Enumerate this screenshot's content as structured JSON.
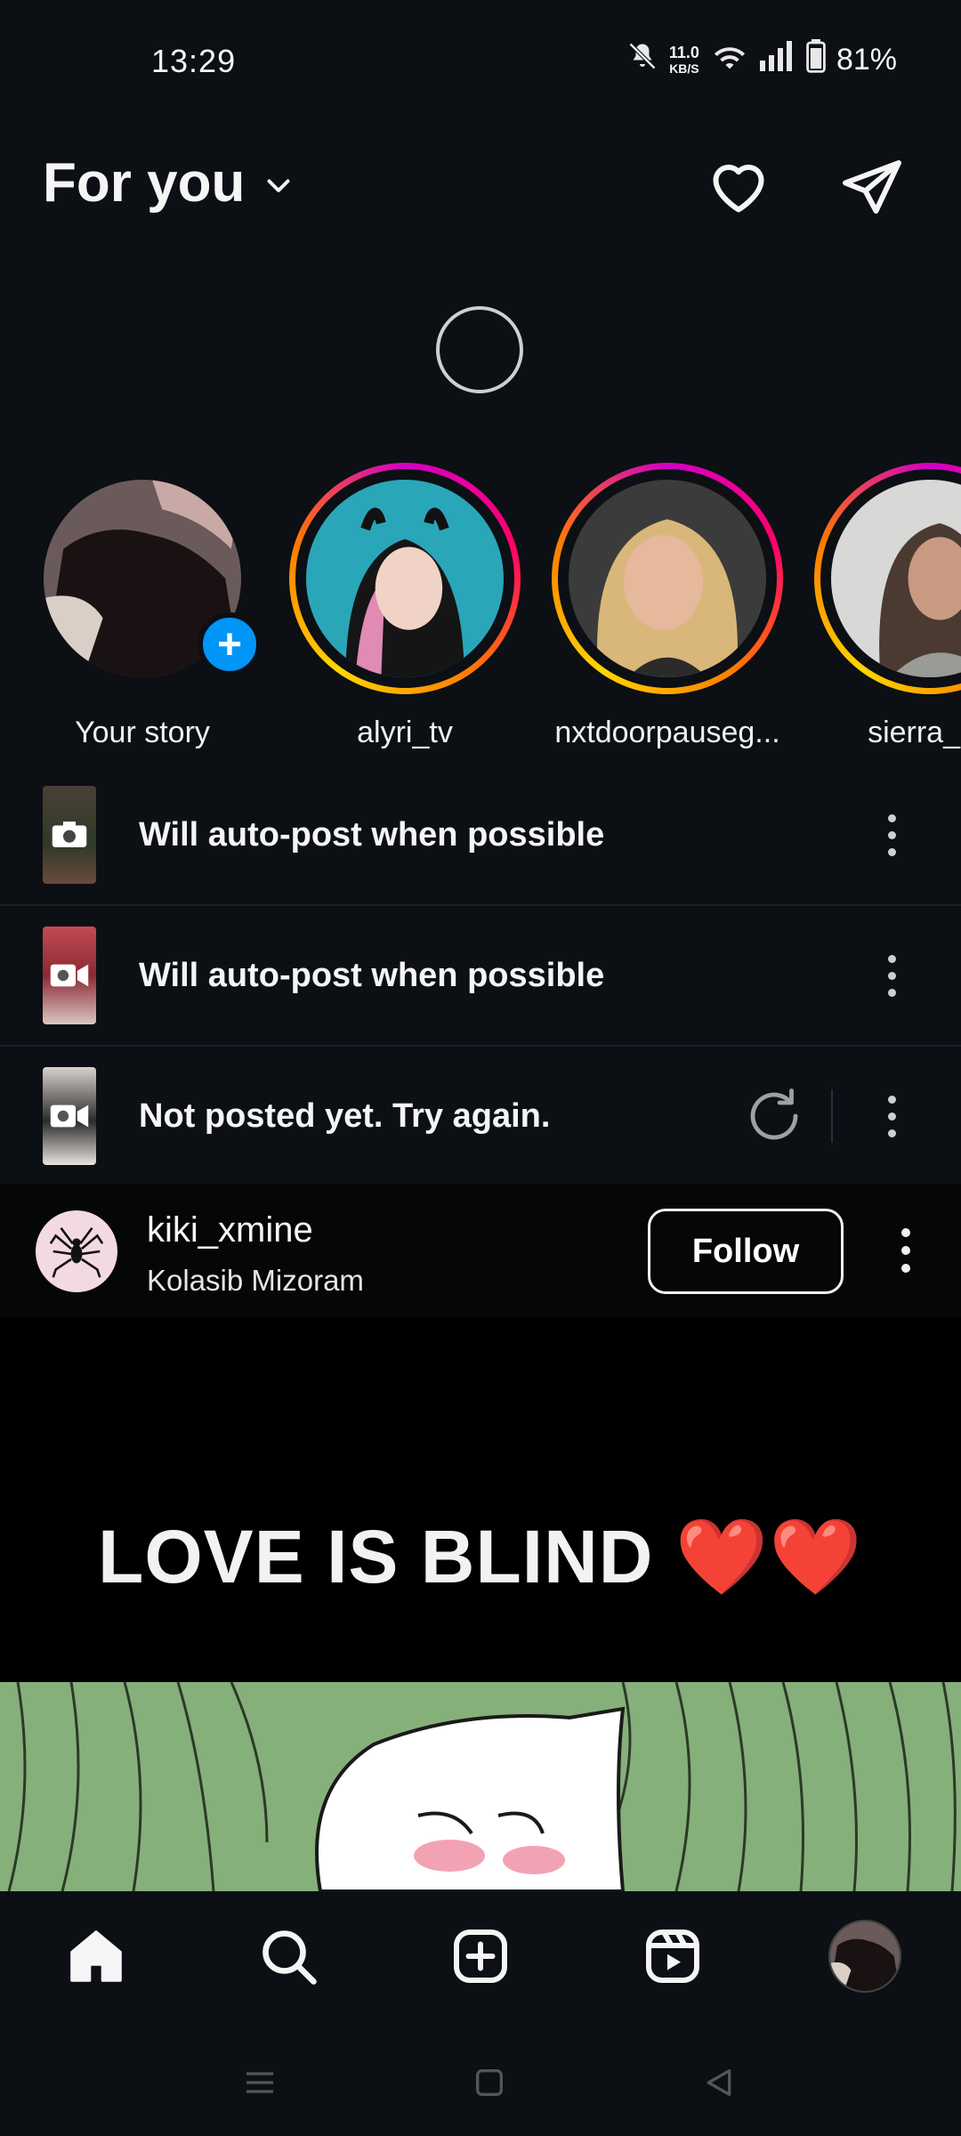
{
  "status_bar": {
    "time": "13:29",
    "net_speed_value": "11.0",
    "net_speed_unit": "KB/S",
    "battery": "81%"
  },
  "header": {
    "title": "For you"
  },
  "stories": [
    {
      "name": "Your story"
    },
    {
      "name": "alyri_tv"
    },
    {
      "name": "nxtdoorpauseg..."
    },
    {
      "name": "sierra_ca"
    }
  ],
  "pending_uploads": [
    {
      "text": "Will auto-post when possible"
    },
    {
      "text": "Will auto-post when possible"
    },
    {
      "text": "Not posted yet. Try again."
    }
  ],
  "post": {
    "username": "kiki_xmine",
    "location": "Kolasib Mizoram",
    "follow_label": "Follow",
    "caption": "LOVE IS BLIND",
    "caption_hearts": "❤️❤️"
  },
  "colors": {
    "background": "#0c0f14",
    "accent_blue": "#0095f6",
    "story_gradient": [
      "#d300c5",
      "#ff0069",
      "#ff7a00",
      "#ffd600"
    ]
  },
  "icons": {
    "header_right": [
      "heart-icon",
      "send-icon"
    ],
    "bottom_nav": [
      "home-icon",
      "search-icon",
      "create-icon",
      "reels-icon",
      "profile-avatar"
    ],
    "system_nav": [
      "menu-icon",
      "home-square-icon",
      "back-icon"
    ]
  }
}
